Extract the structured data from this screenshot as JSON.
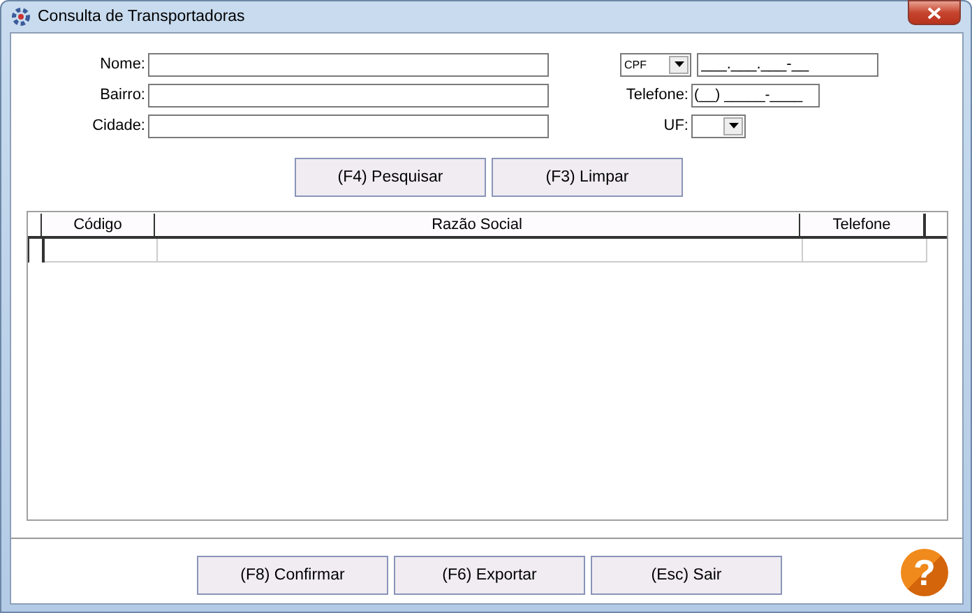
{
  "window": {
    "title": "Consulta de Transportadoras"
  },
  "form": {
    "left_fields": [
      {
        "label": "Nome:"
      },
      {
        "label": "Bairro:"
      },
      {
        "label": "Cidade:"
      }
    ],
    "document": {
      "type": "CPF",
      "value": "___.___.___-__"
    },
    "telefone": {
      "label": "Telefone:",
      "value": "(__) _____-____"
    },
    "uf": {
      "label": "UF:"
    }
  },
  "search_buttons": [
    "(F4) Pesquisar",
    "(F3) Limpar"
  ],
  "table": {
    "columns": [
      "Código",
      "Razão Social",
      "Telefone"
    ]
  },
  "footer_buttons": [
    "(F8) Confirmar",
    "(F6) Exportar",
    "(Esc) Sair"
  ],
  "help": {
    "label": "?"
  }
}
